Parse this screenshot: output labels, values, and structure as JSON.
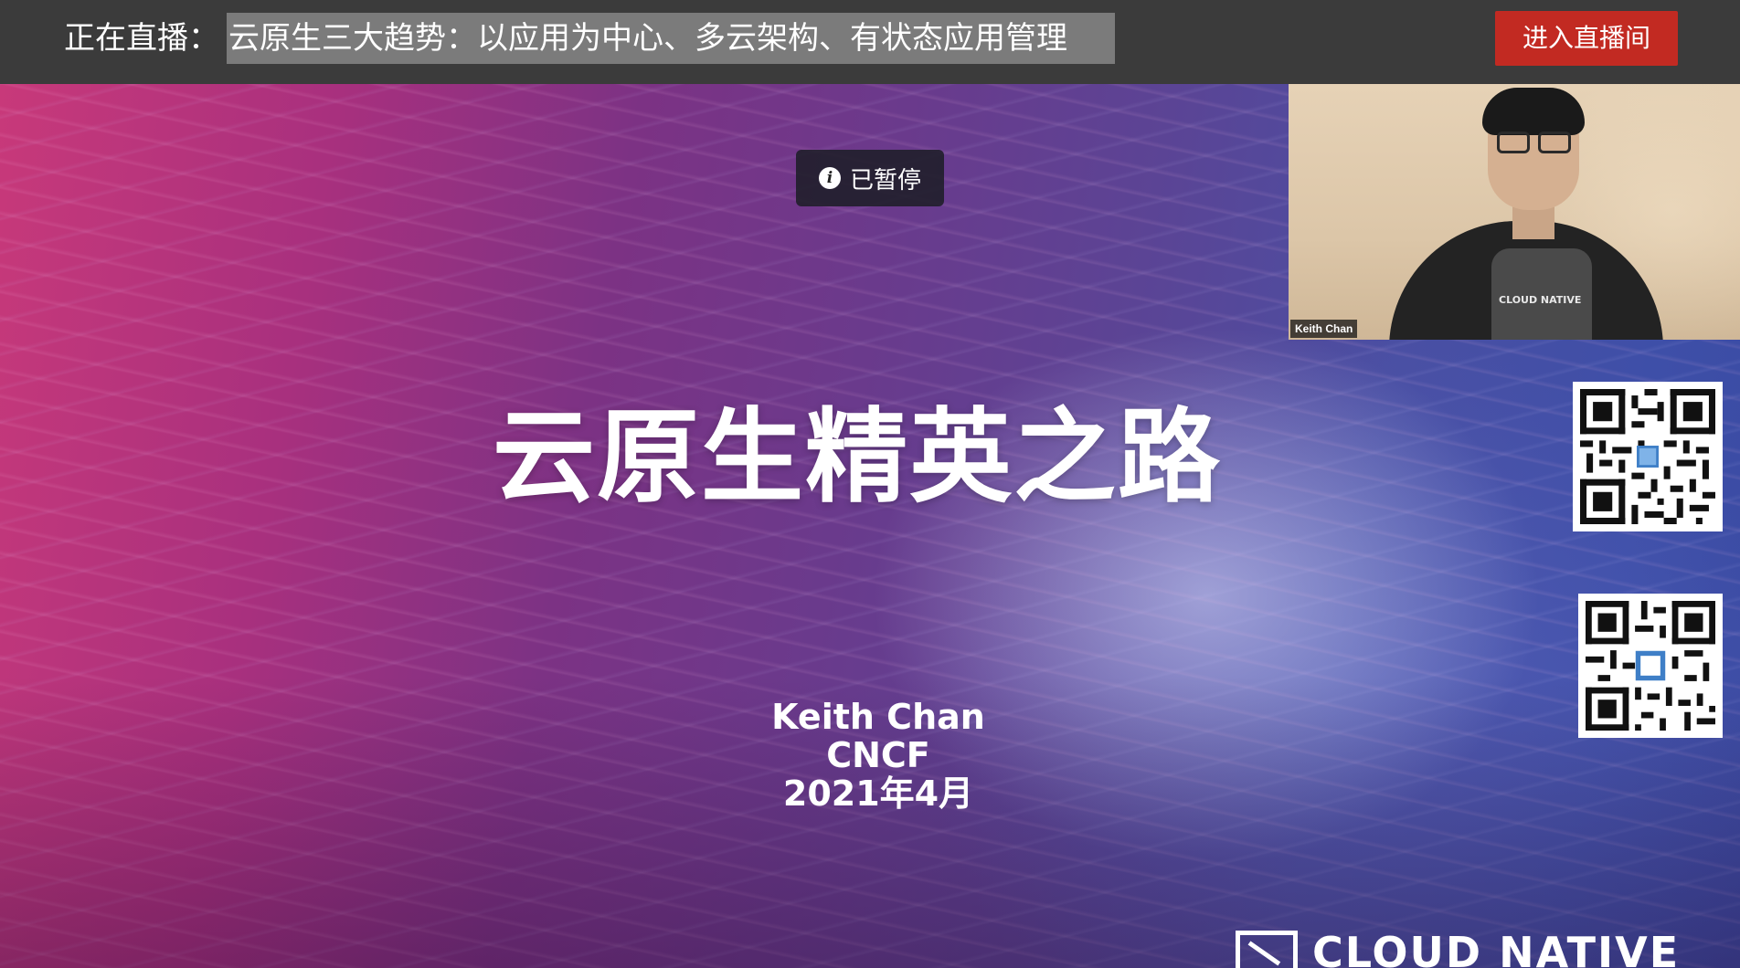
{
  "live_bar": {
    "prefix": "正在直播：",
    "title": "云原生三大趋势：以应用为中心、多云架构、有状态应用管理",
    "enter_button": "进入直播间"
  },
  "player": {
    "paused_label": "已暂停"
  },
  "slide": {
    "title": "云原生精英之路",
    "presenter_name": "Keith Chan",
    "organization": "CNCF",
    "date": "2021年4月",
    "logo_text": "CLOUD NATIVE"
  },
  "webcam": {
    "name_label": "Keith Chan",
    "shirt_text": "CLOUD NATIVE"
  },
  "colors": {
    "top_bar": "#3b3b3b",
    "title_highlight": "#7b7b7b",
    "enter_button": "#c22a22"
  },
  "icons": {
    "paused": "info-icon",
    "qr_1": "qr-code-icon",
    "qr_2": "qr-code-icon"
  }
}
